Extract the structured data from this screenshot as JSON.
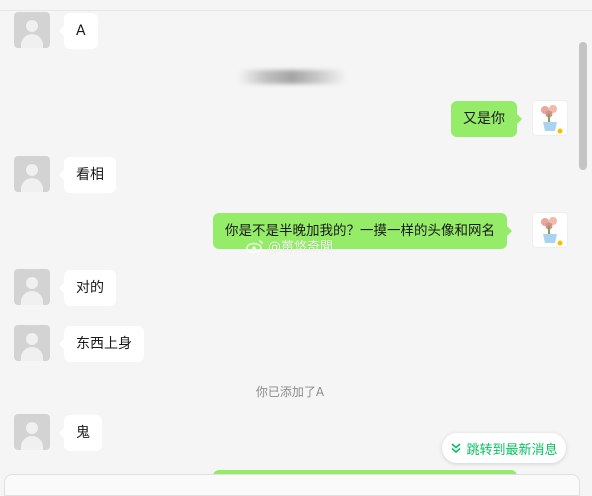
{
  "messages": [
    {
      "side": "in",
      "text": "A"
    },
    {
      "side": "out",
      "text": "又是你"
    },
    {
      "side": "in",
      "text": "看相"
    },
    {
      "side": "out",
      "text": "你是不是半晚加我的？一摸一样的头像和网名"
    },
    {
      "side": "in",
      "text": "对的"
    },
    {
      "side": "in",
      "text": "东西上身"
    },
    {
      "side": "in",
      "text": "鬼"
    }
  ],
  "system": {
    "added_notice": "你已添加了A"
  },
  "watermark": {
    "text": "@薑悠奇聞",
    "icon": "weibo-icon"
  },
  "jump_button": {
    "label": "跳转到最新消息",
    "icon": "double-chevron-down-icon"
  },
  "colors": {
    "incoming_bubble": "#ffffff",
    "outgoing_bubble": "#95ec69",
    "accent": "#07c160"
  }
}
